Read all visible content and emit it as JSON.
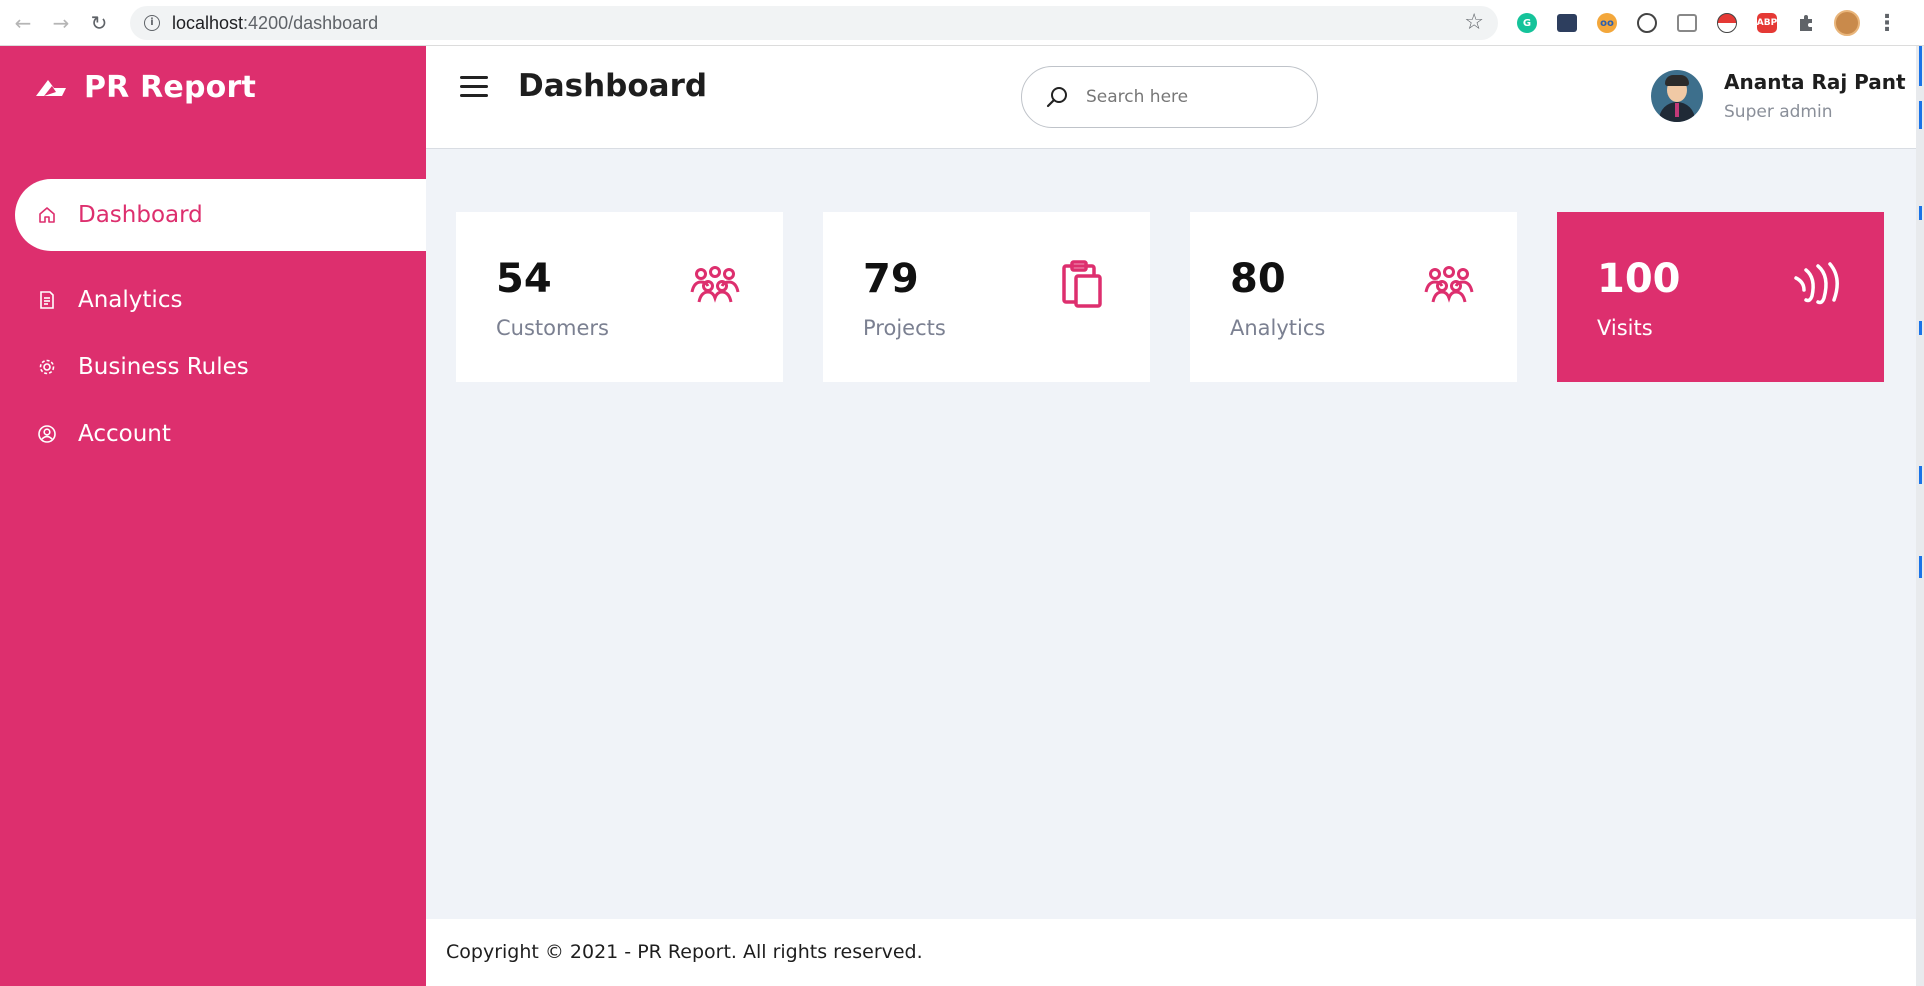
{
  "browser": {
    "url_host": "localhost",
    "url_path": ":4200/dashboard",
    "extensions": [
      "grammarly-icon",
      "folder-icon",
      "glasses-icon",
      "sync-icon",
      "cast-icon",
      "pokeball-icon",
      "abp-icon",
      "puzzle-icon",
      "profile-avatar"
    ],
    "abp_label": "ABP"
  },
  "sidebar": {
    "brand": "PR Report",
    "items": [
      {
        "label": "Dashboard",
        "icon": "home-icon",
        "active": true
      },
      {
        "label": "Analytics",
        "icon": "report-icon",
        "active": false
      },
      {
        "label": "Business Rules",
        "icon": "gear-icon",
        "active": false
      },
      {
        "label": "Account",
        "icon": "user-circle-icon",
        "active": false
      }
    ]
  },
  "header": {
    "title": "Dashboard",
    "search_placeholder": "Search here",
    "user": {
      "name": "Ananta Raj Pant",
      "role": "Super admin"
    }
  },
  "cards": [
    {
      "value": "54",
      "label": "Customers",
      "icon": "people-icon",
      "highlight": false
    },
    {
      "value": "79",
      "label": "Projects",
      "icon": "clipboard-icon",
      "highlight": false
    },
    {
      "value": "80",
      "label": "Analytics",
      "icon": "people-icon",
      "highlight": false
    },
    {
      "value": "100",
      "label": "Visits",
      "icon": "signal-waves-icon",
      "highlight": true
    }
  ],
  "footer": {
    "copyright": "Copyright © 2021 - PR Report. All rights reserved."
  },
  "colors": {
    "accent": "#dd2f6e",
    "background": "#f0f3f8",
    "card": "#ffffff",
    "muted_text": "#7b8091"
  }
}
